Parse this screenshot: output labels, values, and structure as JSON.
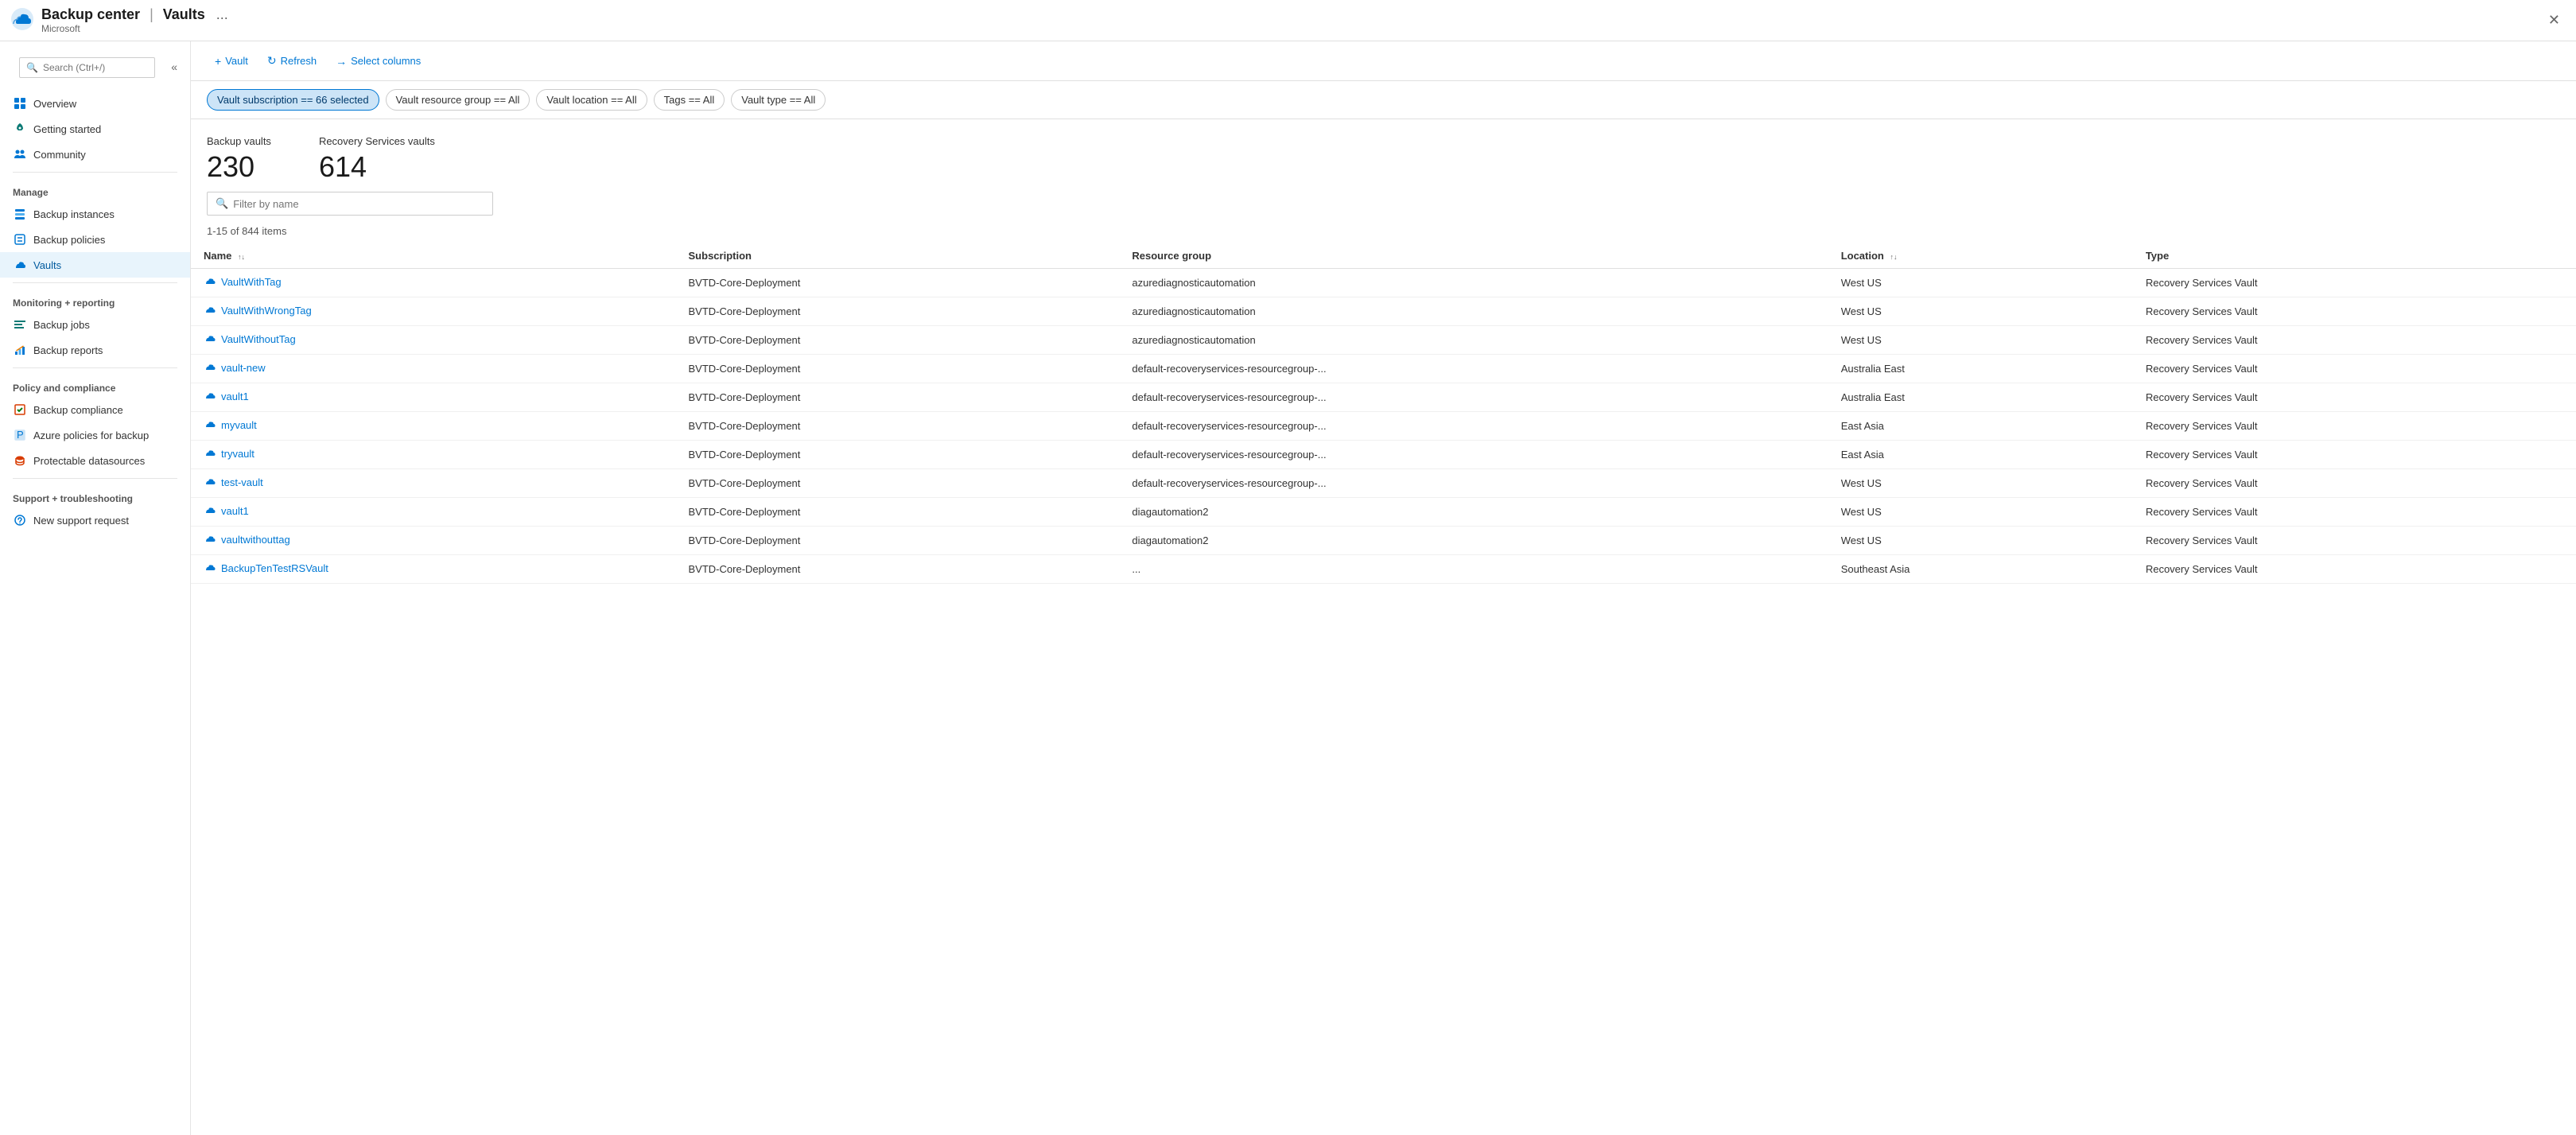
{
  "titleBar": {
    "appName": "Backup center",
    "separator": "|",
    "pageName": "Vaults",
    "subTitle": "Microsoft",
    "dotsLabel": "...",
    "closeLabel": "✕"
  },
  "sidebar": {
    "searchPlaceholder": "Search (Ctrl+/)",
    "collapseIcon": "«",
    "navItems": [
      {
        "id": "overview",
        "label": "Overview",
        "icon": "overview",
        "active": false
      },
      {
        "id": "getting-started",
        "label": "Getting started",
        "icon": "rocket",
        "active": false
      },
      {
        "id": "community",
        "label": "Community",
        "icon": "community",
        "active": false
      }
    ],
    "sections": [
      {
        "title": "Manage",
        "items": [
          {
            "id": "backup-instances",
            "label": "Backup instances",
            "icon": "instances",
            "active": false
          },
          {
            "id": "backup-policies",
            "label": "Backup policies",
            "icon": "policies",
            "active": false
          },
          {
            "id": "vaults",
            "label": "Vaults",
            "icon": "vault",
            "active": true
          }
        ]
      },
      {
        "title": "Monitoring + reporting",
        "items": [
          {
            "id": "backup-jobs",
            "label": "Backup jobs",
            "icon": "jobs",
            "active": false
          },
          {
            "id": "backup-reports",
            "label": "Backup reports",
            "icon": "reports",
            "active": false
          }
        ]
      },
      {
        "title": "Policy and compliance",
        "items": [
          {
            "id": "backup-compliance",
            "label": "Backup compliance",
            "icon": "compliance",
            "active": false
          },
          {
            "id": "azure-policies",
            "label": "Azure policies for backup",
            "icon": "azure-policy",
            "active": false
          },
          {
            "id": "protectable-datasources",
            "label": "Protectable datasources",
            "icon": "datasources",
            "active": false
          }
        ]
      },
      {
        "title": "Support + troubleshooting",
        "items": [
          {
            "id": "new-support",
            "label": "New support request",
            "icon": "support",
            "active": false
          }
        ]
      }
    ]
  },
  "toolbar": {
    "buttons": [
      {
        "id": "vault",
        "label": "Vault",
        "icon": "+"
      },
      {
        "id": "refresh",
        "label": "Refresh",
        "icon": "↻"
      },
      {
        "id": "select-columns",
        "label": "Select columns",
        "icon": "→"
      }
    ]
  },
  "filters": [
    {
      "id": "subscription",
      "label": "Vault subscription == 66 selected",
      "active": true
    },
    {
      "id": "resource-group",
      "label": "Vault resource group == All",
      "active": false
    },
    {
      "id": "location",
      "label": "Vault location == All",
      "active": false
    },
    {
      "id": "tags",
      "label": "Tags == All",
      "active": false
    },
    {
      "id": "vault-type",
      "label": "Vault type == All",
      "active": false
    }
  ],
  "stats": [
    {
      "id": "backup-vaults",
      "label": "Backup vaults",
      "value": "230"
    },
    {
      "id": "recovery-vaults",
      "label": "Recovery Services vaults",
      "value": "614"
    }
  ],
  "search": {
    "placeholder": "Filter by name"
  },
  "itemsCount": "1-15 of 844 items",
  "table": {
    "columns": [
      {
        "id": "name",
        "label": "Name",
        "sortable": true
      },
      {
        "id": "subscription",
        "label": "Subscription",
        "sortable": false
      },
      {
        "id": "resource-group",
        "label": "Resource group",
        "sortable": false
      },
      {
        "id": "location",
        "label": "Location",
        "sortable": true
      },
      {
        "id": "type",
        "label": "Type",
        "sortable": false
      }
    ],
    "rows": [
      {
        "name": "VaultWithTag",
        "subscription": "BVTD-Core-Deployment",
        "resourceGroup": "azurediagnosticautomation",
        "location": "West US",
        "type": "Recovery Services Vault"
      },
      {
        "name": "VaultWithWrongTag",
        "subscription": "BVTD-Core-Deployment",
        "resourceGroup": "azurediagnosticautomation",
        "location": "West US",
        "type": "Recovery Services Vault"
      },
      {
        "name": "VaultWithoutTag",
        "subscription": "BVTD-Core-Deployment",
        "resourceGroup": "azurediagnosticautomation",
        "location": "West US",
        "type": "Recovery Services Vault"
      },
      {
        "name": "vault-new",
        "subscription": "BVTD-Core-Deployment",
        "resourceGroup": "default-recoveryservices-resourcegroup-...",
        "location": "Australia East",
        "type": "Recovery Services Vault"
      },
      {
        "name": "vault1",
        "subscription": "BVTD-Core-Deployment",
        "resourceGroup": "default-recoveryservices-resourcegroup-...",
        "location": "Australia East",
        "type": "Recovery Services Vault"
      },
      {
        "name": "myvault",
        "subscription": "BVTD-Core-Deployment",
        "resourceGroup": "default-recoveryservices-resourcegroup-...",
        "location": "East Asia",
        "type": "Recovery Services Vault"
      },
      {
        "name": "tryvault",
        "subscription": "BVTD-Core-Deployment",
        "resourceGroup": "default-recoveryservices-resourcegroup-...",
        "location": "East Asia",
        "type": "Recovery Services Vault"
      },
      {
        "name": "test-vault",
        "subscription": "BVTD-Core-Deployment",
        "resourceGroup": "default-recoveryservices-resourcegroup-...",
        "location": "West US",
        "type": "Recovery Services Vault"
      },
      {
        "name": "vault1",
        "subscription": "BVTD-Core-Deployment",
        "resourceGroup": "diagautomation2",
        "location": "West US",
        "type": "Recovery Services Vault"
      },
      {
        "name": "vaultwithouttag",
        "subscription": "BVTD-Core-Deployment",
        "resourceGroup": "diagautomation2",
        "location": "West US",
        "type": "Recovery Services Vault"
      },
      {
        "name": "BackupTenTestRSVault",
        "subscription": "BVTD-Core-Deployment",
        "resourceGroup": "...",
        "location": "Southeast Asia",
        "type": "Recovery Services Vault"
      }
    ]
  }
}
